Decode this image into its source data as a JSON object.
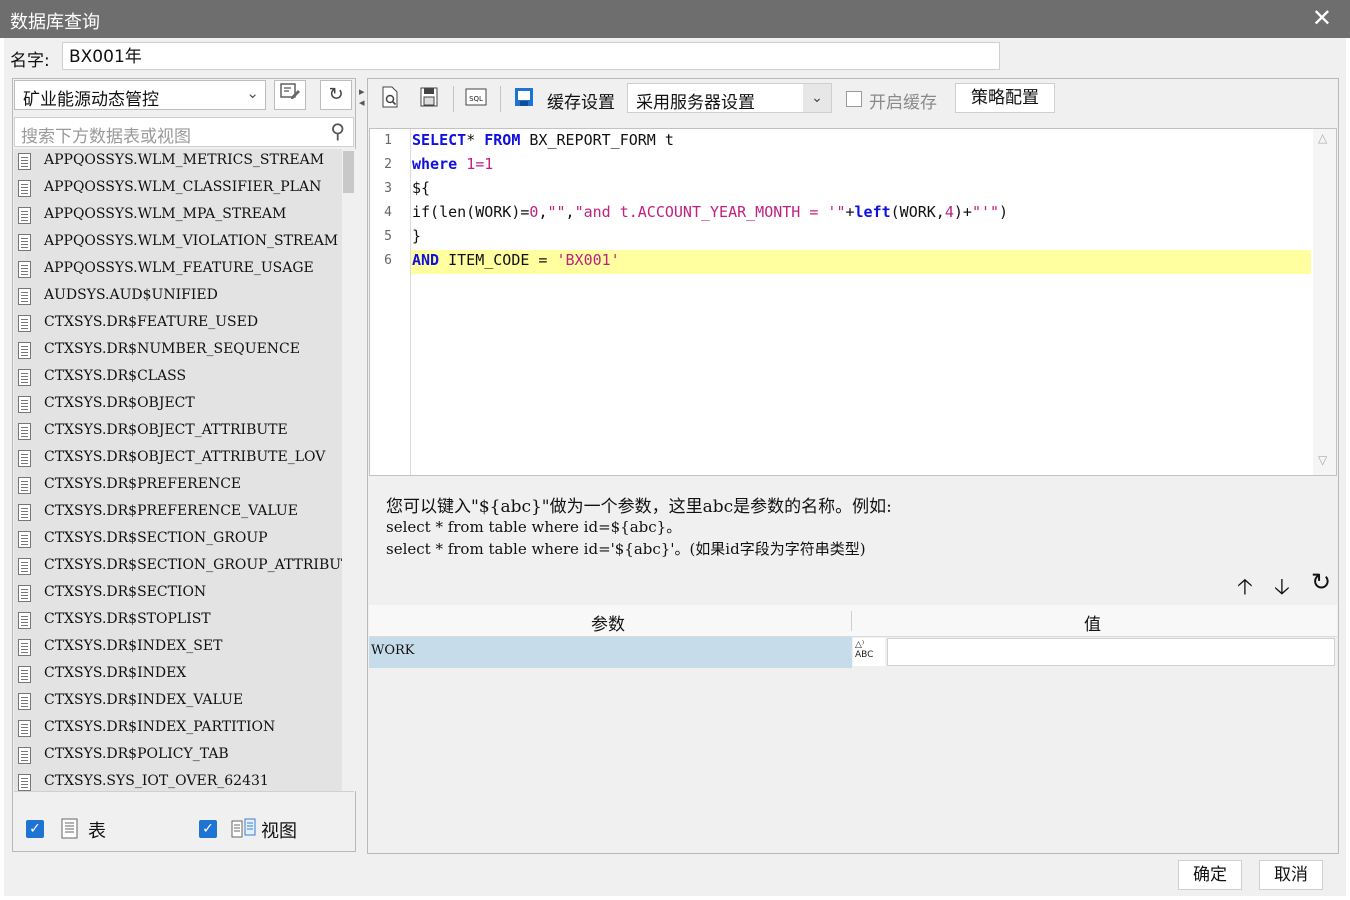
{
  "window": {
    "title": "数据库查询",
    "close_symbol": "✕"
  },
  "name": {
    "label": "名字:",
    "value": "BX001年"
  },
  "datasource": {
    "selected": "矿业能源动态管控"
  },
  "search": {
    "placeholder": "搜索下方数据表或视图"
  },
  "tables": [
    "APPQOSSYS.WLM_METRICS_STREAM",
    "APPQOSSYS.WLM_CLASSIFIER_PLAN",
    "APPQOSSYS.WLM_MPA_STREAM",
    "APPQOSSYS.WLM_VIOLATION_STREAM",
    "APPQOSSYS.WLM_FEATURE_USAGE",
    "AUDSYS.AUD$UNIFIED",
    "CTXSYS.DR$FEATURE_USED",
    "CTXSYS.DR$NUMBER_SEQUENCE",
    "CTXSYS.DR$CLASS",
    "CTXSYS.DR$OBJECT",
    "CTXSYS.DR$OBJECT_ATTRIBUTE",
    "CTXSYS.DR$OBJECT_ATTRIBUTE_LOV",
    "CTXSYS.DR$PREFERENCE",
    "CTXSYS.DR$PREFERENCE_VALUE",
    "CTXSYS.DR$SECTION_GROUP",
    "CTXSYS.DR$SECTION_GROUP_ATTRIBUTE",
    "CTXSYS.DR$SECTION",
    "CTXSYS.DR$STOPLIST",
    "CTXSYS.DR$INDEX_SET",
    "CTXSYS.DR$INDEX",
    "CTXSYS.DR$INDEX_VALUE",
    "CTXSYS.DR$INDEX_PARTITION",
    "CTXSYS.DR$POLICY_TAB",
    "CTXSYS.SYS_IOT_OVER_62431"
  ],
  "filters": {
    "table_label": "表",
    "view_label": "视图",
    "table_checked": true,
    "view_checked": true
  },
  "toolbar": {
    "cache_settings_label": "缓存设置",
    "cache_mode": "采用服务器设置",
    "enable_cache_label": "开启缓存",
    "strategy_label": "策略配置",
    "sql_icon_text": "SQL"
  },
  "sql_lines": [
    {
      "n": "1",
      "parts": [
        [
          "kw",
          "SELECT"
        ],
        [
          "",
          "* "
        ],
        [
          "kw",
          "FROM"
        ],
        [
          "",
          " BX_REPORT_FORM t"
        ]
      ]
    },
    {
      "n": "2",
      "parts": [
        [
          "kw",
          "where"
        ],
        [
          "",
          " "
        ],
        [
          "num",
          "1=1"
        ]
      ]
    },
    {
      "n": "3",
      "parts": [
        [
          "",
          "${"
        ]
      ]
    },
    {
      "n": "4",
      "parts": [
        [
          "",
          "if(len(WORK)="
        ],
        [
          "num",
          "0"
        ],
        [
          "",
          ","
        ],
        [
          "str",
          "\"\""
        ],
        [
          "",
          ","
        ],
        [
          "str",
          "\"and t.ACCOUNT_YEAR_MONTH = '\""
        ],
        [
          "",
          "+"
        ],
        [
          "fn",
          "left"
        ],
        [
          "",
          "(WORK,"
        ],
        [
          "num",
          "4"
        ],
        [
          "",
          ")+"
        ],
        [
          "str",
          "\"'\""
        ],
        [
          "",
          ")"
        ]
      ]
    },
    {
      "n": "5",
      "parts": [
        [
          "",
          "}"
        ]
      ]
    },
    {
      "n": "6",
      "parts": [
        [
          "kw",
          "AND"
        ],
        [
          "",
          " ITEM_CODE = "
        ],
        [
          "str",
          "'BX001'"
        ]
      ]
    }
  ],
  "hint": {
    "line1": "您可以键入\"${abc}\"做为一个参数，这里abc是参数的名称。例如:",
    "line2": "select * from table where id=${abc}。",
    "line3": "select * from table where id='${abc}'。(如果id字段为字符串类型)"
  },
  "params": {
    "col_param": "参数",
    "col_value": "值",
    "rows": [
      {
        "name": "WORK",
        "value": "",
        "type_icon": "ABC"
      }
    ]
  },
  "footer": {
    "ok_label": "确定",
    "cancel_label": "取消"
  },
  "colors": {
    "titlebar": "#6e6e6e",
    "checkbox": "#1e73d3",
    "highlight_line": "#ffffa0",
    "param_row": "#c7dceb"
  }
}
